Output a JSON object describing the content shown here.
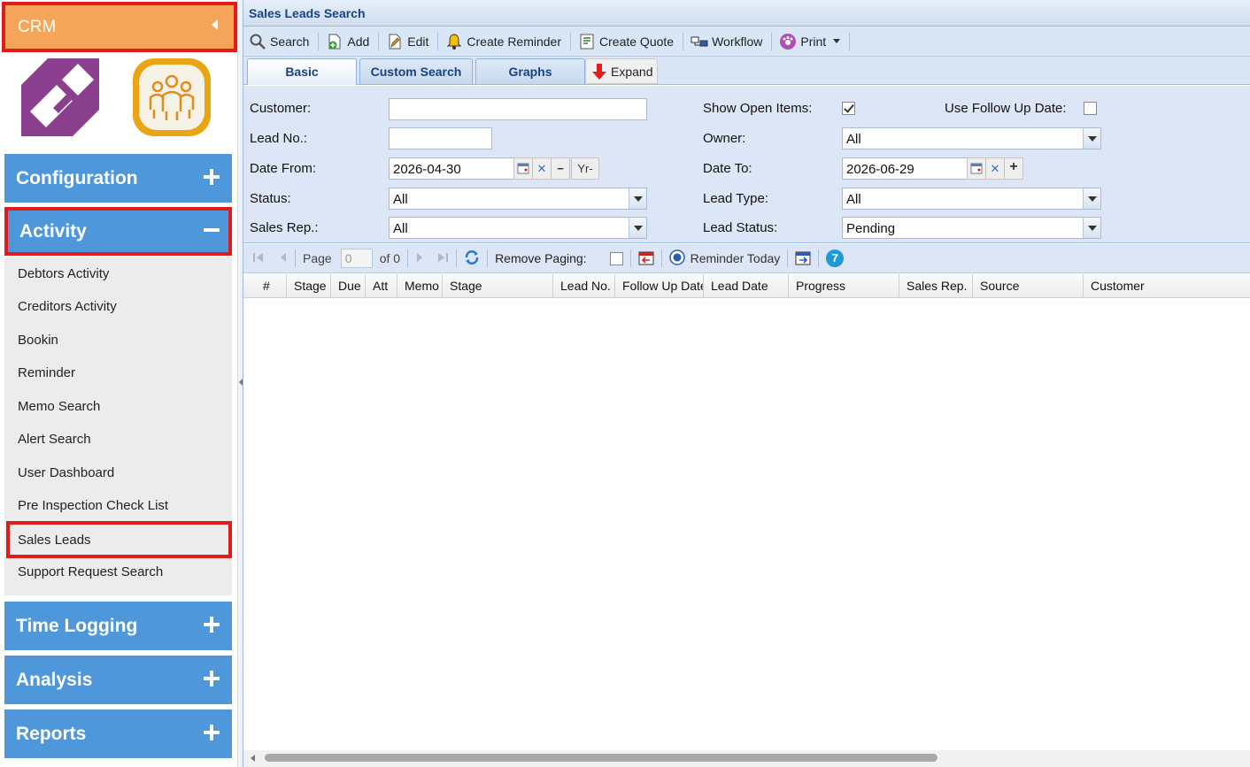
{
  "sidebar": {
    "app_title": "CRM",
    "sections": {
      "configuration": "Configuration",
      "activity": "Activity",
      "time_logging": "Time Logging",
      "analysis": "Analysis",
      "reports": "Reports"
    },
    "activity_items": [
      "Debtors Activity",
      "Creditors Activity",
      "Bookin",
      "Reminder",
      "Memo Search",
      "Alert Search",
      "User Dashboard",
      "Pre Inspection Check List",
      "Sales Leads",
      "Support Request Search"
    ],
    "selected_item": "Sales Leads"
  },
  "panel": {
    "title": "Sales Leads Search",
    "toolbar": {
      "search": "Search",
      "add": "Add",
      "edit": "Edit",
      "create_reminder": "Create Reminder",
      "create_quote": "Create Quote",
      "workflow": "Workflow",
      "print": "Print"
    },
    "tabs": {
      "basic": "Basic",
      "custom_search": "Custom Search",
      "graphs": "Graphs",
      "expand": "Expand"
    }
  },
  "form": {
    "customer_label": "Customer:",
    "customer_value": "",
    "lead_no_label": "Lead No.:",
    "lead_no_value": "",
    "date_from_label": "Date From:",
    "date_from_value": "2026-04-30",
    "yr_button": "Yr-",
    "status_label": "Status:",
    "status_value": "All",
    "sales_rep_label": "Sales Rep.:",
    "sales_rep_value": "All",
    "show_open_items_label": "Show Open Items:",
    "show_open_items_checked": true,
    "use_follow_up_label": "Use Follow Up Date:",
    "use_follow_up_checked": false,
    "owner_label": "Owner:",
    "owner_value": "All",
    "date_to_label": "Date To:",
    "date_to_value": "2026-06-29",
    "lead_type_label": "Lead Type:",
    "lead_type_value": "All",
    "lead_status_label": "Lead Status:",
    "lead_status_value": "Pending"
  },
  "pager": {
    "page_label": "Page",
    "page_value": "0",
    "of_label": "of 0",
    "remove_paging_label": "Remove Paging:",
    "reminder_today_label": "Reminder Today",
    "badge_count": "7"
  },
  "grid": {
    "columns": [
      "#",
      "Stage",
      "Due",
      "Att",
      "Memo",
      "Stage",
      "Lead No.",
      "Follow Up Date",
      "Lead Date",
      "Progress",
      "Sales Rep.",
      "Source",
      "Customer"
    ],
    "rows": []
  },
  "colors": {
    "crm_header": "#f4a55a",
    "section_blue": "#4e97db",
    "highlight_red": "#e01b1b",
    "panel_title_text": "#15428b",
    "form_bg": "#dde6f7"
  }
}
